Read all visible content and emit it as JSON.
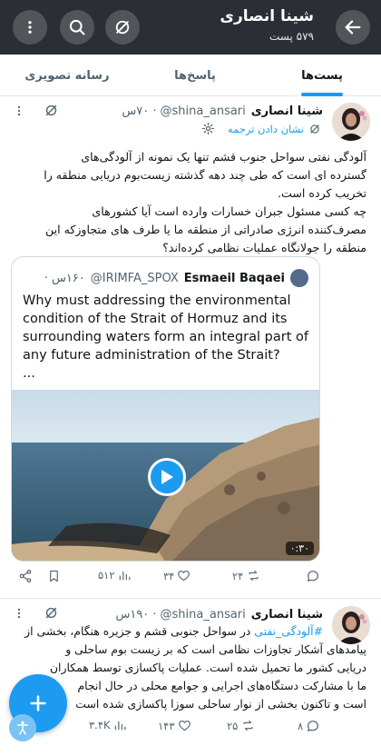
{
  "header": {
    "title": "شینا انصاری",
    "subtitle": "۵۷۹ پست",
    "back_icon": "arrow-back-icon",
    "more_icon": "more-vertical-icon",
    "search_icon": "search-icon",
    "grok_icon": "grok-icon"
  },
  "tabs": [
    {
      "label": "پست‌ها",
      "active": true
    },
    {
      "label": "پاسخ‌ها",
      "active": false
    },
    {
      "label": "رسانه تصویری",
      "active": false
    }
  ],
  "tweets": [
    {
      "name": "شینا انصاری",
      "handle": "@shina_ansari",
      "time": "۷۰س",
      "translate_label": "نشان دادن ترجمه",
      "body_lines": [
        "آلودگی نفتی سواحل جنوب قشم تنها یک نمونه از آلودگی‌های",
        "گسترده ای است که طی چند دهه گذشته زیست‌بوم دریایی منطقه را",
        "تخریب کرده است.",
        "چه کسی مسئول جبران خسارات وارده است آیا کشورهای",
        "مصرف‌کننده انرژی صادراتی از منطقه ما یا طرف های متجاوزکه این",
        "منطقه را جولانگاه عملیات نظامی کرده‌اند؟"
      ],
      "quote": {
        "name": "Esmaeil Baqaei",
        "handle": "@IRIMFA_SPOX",
        "time": "۱۶۰س",
        "text": "Why must addressing the environmental condition of the Strait of Hormuz and its surrounding waters form an integral part of any future administration of the Strait?",
        "ellipsis": "...",
        "duration": "۰:۳۰"
      },
      "actions": {
        "replies": "",
        "reposts": "۲۴",
        "likes": "۳۴",
        "views": "۵۱۲"
      }
    },
    {
      "name": "شینا انصاری",
      "handle": "@shina_ansari",
      "time": "۱۹۰س",
      "hashtag": "#آلودگی_نفتی",
      "body_first_rest": " در سواحل جنوبی قشم و جزیره هنگام، بخشی از",
      "body_lines": [
        "پیامدهای آشکار تجاوزات نظامی است که بر زیست بوم ساحلی و",
        "دریایی کشور ما تحمیل شده است. عملیات پاکسازی توسط همکاران",
        "ما با مشارکت دستگاه‌های اجرایی و جوامع محلی در حال انجام",
        "است و تاکنون بخشی از نوار ساحلی سوزا پاکسازی شده است"
      ],
      "actions": {
        "replies": "۸",
        "reposts": "۲۵",
        "likes": "۱۴۳",
        "views": "۳.۴K"
      }
    }
  ],
  "colors": {
    "accent": "#1d9bf0",
    "header_bg": "#2b2f35",
    "muted": "#536471"
  }
}
